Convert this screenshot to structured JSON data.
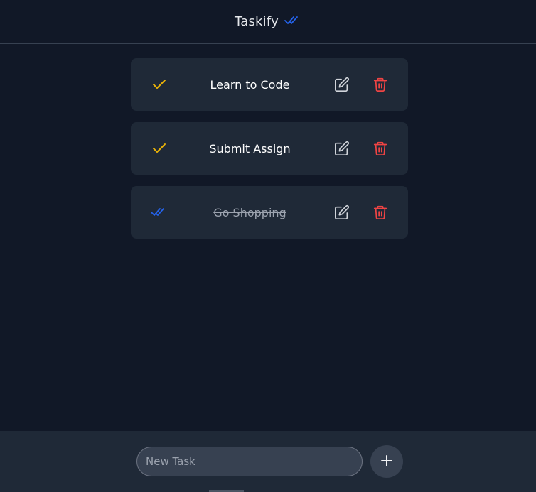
{
  "header": {
    "title": "Taskify",
    "icon": "double-check-icon",
    "icon_color": "#2563eb"
  },
  "tasks": [
    {
      "text": "Learn to Code",
      "completed": false,
      "status_icon": "check-icon",
      "status_color": "#eab308"
    },
    {
      "text": "Submit Assign",
      "completed": false,
      "status_icon": "check-icon",
      "status_color": "#eab308"
    },
    {
      "text": "Go Shopping",
      "completed": true,
      "status_icon": "double-check-icon",
      "status_color": "#2563eb"
    }
  ],
  "task_actions": {
    "edit_icon": "pencil-icon",
    "edit_color": "#d1d5db",
    "delete_icon": "trash-icon",
    "delete_color": "#ef4444"
  },
  "footer": {
    "input_placeholder": "New Task",
    "input_value": "",
    "add_icon": "plus-icon"
  }
}
